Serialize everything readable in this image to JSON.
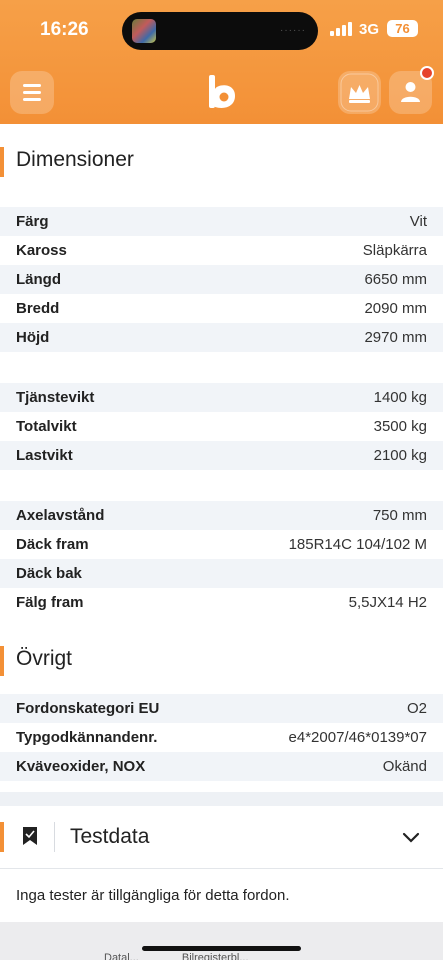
{
  "status_bar": {
    "time": "16:26",
    "network": "3G",
    "battery": "76"
  },
  "header": {
    "logo_letter": "b"
  },
  "sections": {
    "dimensions": {
      "title": "Dimensioner",
      "groups": [
        [
          {
            "key": "Färg",
            "value": "Vit"
          },
          {
            "key": "Kaross",
            "value": "Släpkärra"
          },
          {
            "key": "Längd",
            "value": "6650 mm"
          },
          {
            "key": "Bredd",
            "value": "2090 mm"
          },
          {
            "key": "Höjd",
            "value": "2970 mm"
          }
        ],
        [
          {
            "key": "Tjänstevikt",
            "value": "1400 kg"
          },
          {
            "key": "Totalvikt",
            "value": "3500 kg"
          },
          {
            "key": "Lastvikt",
            "value": "2100 kg"
          }
        ],
        [
          {
            "key": "Axelavstånd",
            "value": "750 mm"
          },
          {
            "key": "Däck fram",
            "value": "185R14C 104/102 M"
          },
          {
            "key": "Däck bak",
            "value": ""
          },
          {
            "key": "Fälg fram",
            "value": "5,5JX14 H2"
          }
        ]
      ]
    },
    "other": {
      "title": "Övrigt",
      "rows": [
        {
          "key": "Fordonskategori EU",
          "value": "O2"
        },
        {
          "key": "Typgodkännandenr.",
          "value": "e4*2007/46*0139*07"
        },
        {
          "key": "Kväveoxider, NOX",
          "value": "Okänd"
        }
      ]
    },
    "testdata": {
      "title": "Testdata",
      "empty_message": "Inga tester är tillgängliga för detta fordon."
    }
  },
  "footer": {
    "text": "Datal... Bilregisterbl..."
  },
  "colors": {
    "accent": "#f39036",
    "row_shade": "#f1f4f8",
    "notification": "#e6432d"
  }
}
